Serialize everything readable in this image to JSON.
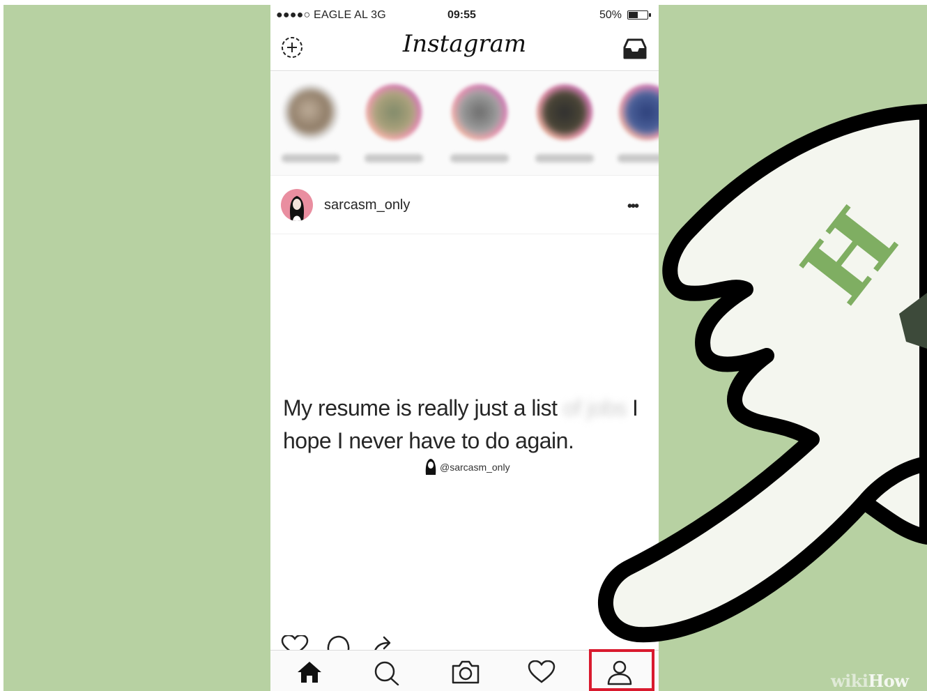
{
  "statusbar": {
    "carrier": "●●●●○ EAGLE AL  3G",
    "time": "09:55",
    "battery": "50%"
  },
  "header": {
    "logo": "Instagram",
    "left_icon": "camera-add-icon",
    "right_icon": "inbox-icon"
  },
  "stories": {
    "count": 5
  },
  "post": {
    "username": "sarcasm_only",
    "text_line1_start": "My resume is really just a list",
    "text_line1_blurred": "of jobs",
    "text_line1_end": "I",
    "text_line2": "hope I never have to do again.",
    "watermark": "@sarcasm_only"
  },
  "actions": [
    "heart-icon",
    "comment-icon",
    "share-icon"
  ],
  "tabbar": {
    "tabs": [
      "home-icon",
      "search-icon",
      "camera-icon",
      "activity-heart-icon",
      "profile-icon"
    ],
    "highlighted": "profile-icon",
    "highlight_color": "#d91a2e"
  },
  "branding": {
    "wiki": "wiki",
    "how": "How"
  },
  "colors": {
    "background": "#b7d1a2",
    "hand_fill": "#f4f6ef",
    "hand_stroke": "#000000",
    "brand_green": "#7fae62"
  }
}
